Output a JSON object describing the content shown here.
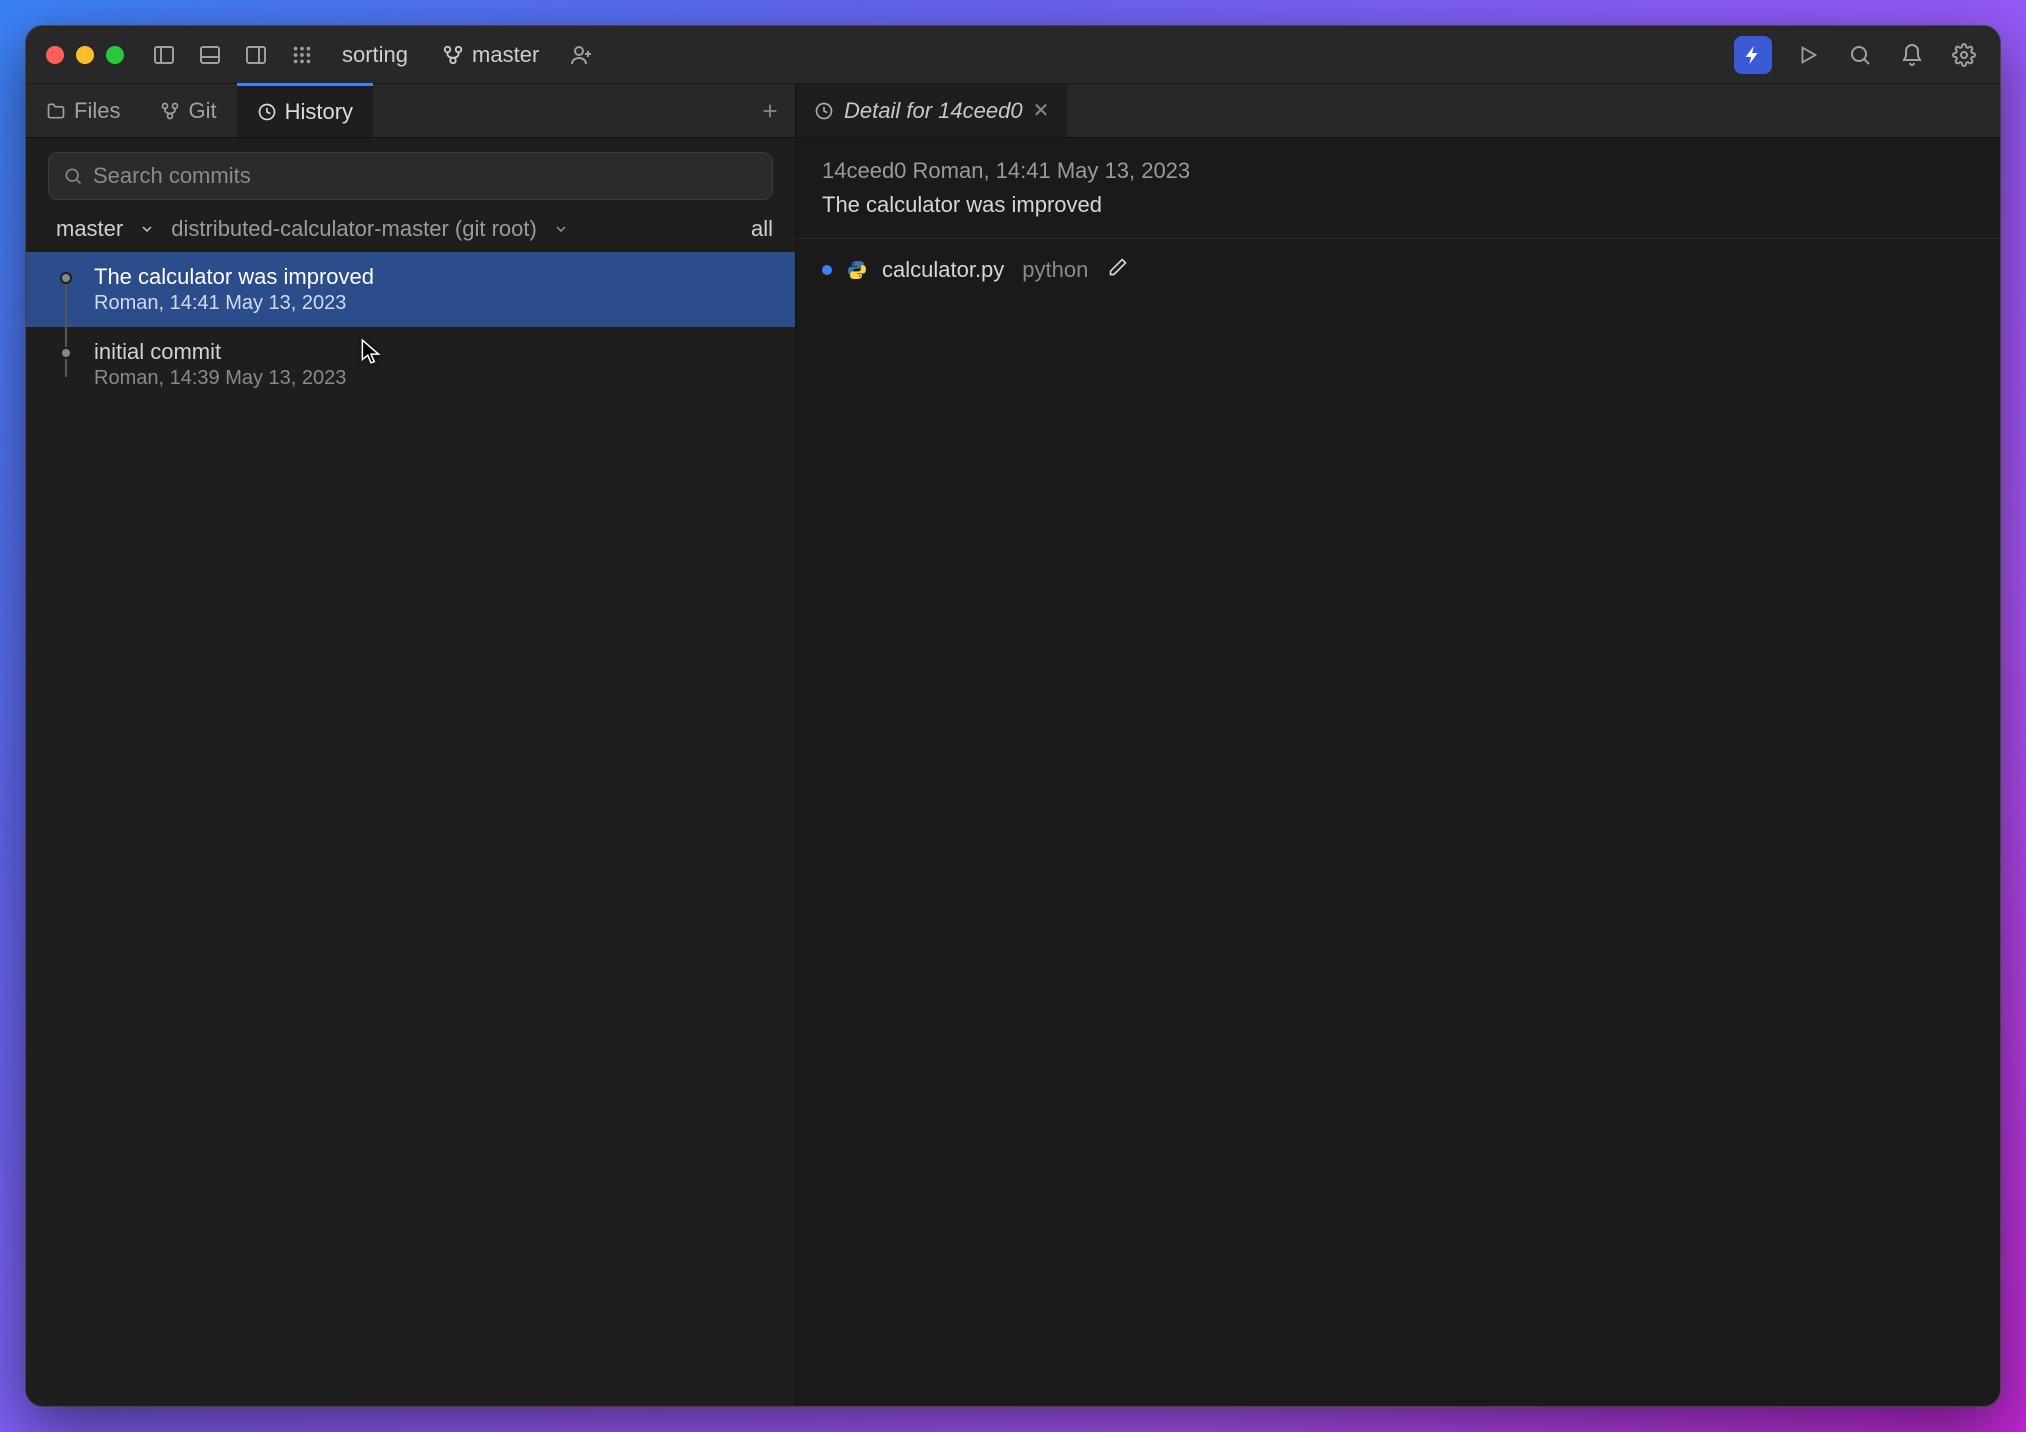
{
  "titlebar": {
    "project_name": "sorting",
    "branch": "master"
  },
  "left_tabs": {
    "files": "Files",
    "git": "Git",
    "history": "History"
  },
  "editor_tab": {
    "label": "Detail for 14ceed0"
  },
  "sidebar": {
    "search_placeholder": "Search commits",
    "branch_filter": "master",
    "root_filter": "distributed-calculator-master (git root)",
    "all_label": "all"
  },
  "commits": [
    {
      "title": "The calculator was improved",
      "meta": "Roman, 14:41 May 13, 2023",
      "selected": true
    },
    {
      "title": "initial commit",
      "meta": "Roman, 14:39 May 13, 2023",
      "selected": false
    }
  ],
  "detail": {
    "header_line1": "14ceed0 Roman, 14:41 May 13, 2023",
    "header_line2": "The calculator was improved",
    "files": [
      {
        "name": "calculator.py",
        "folder": "python"
      }
    ]
  }
}
